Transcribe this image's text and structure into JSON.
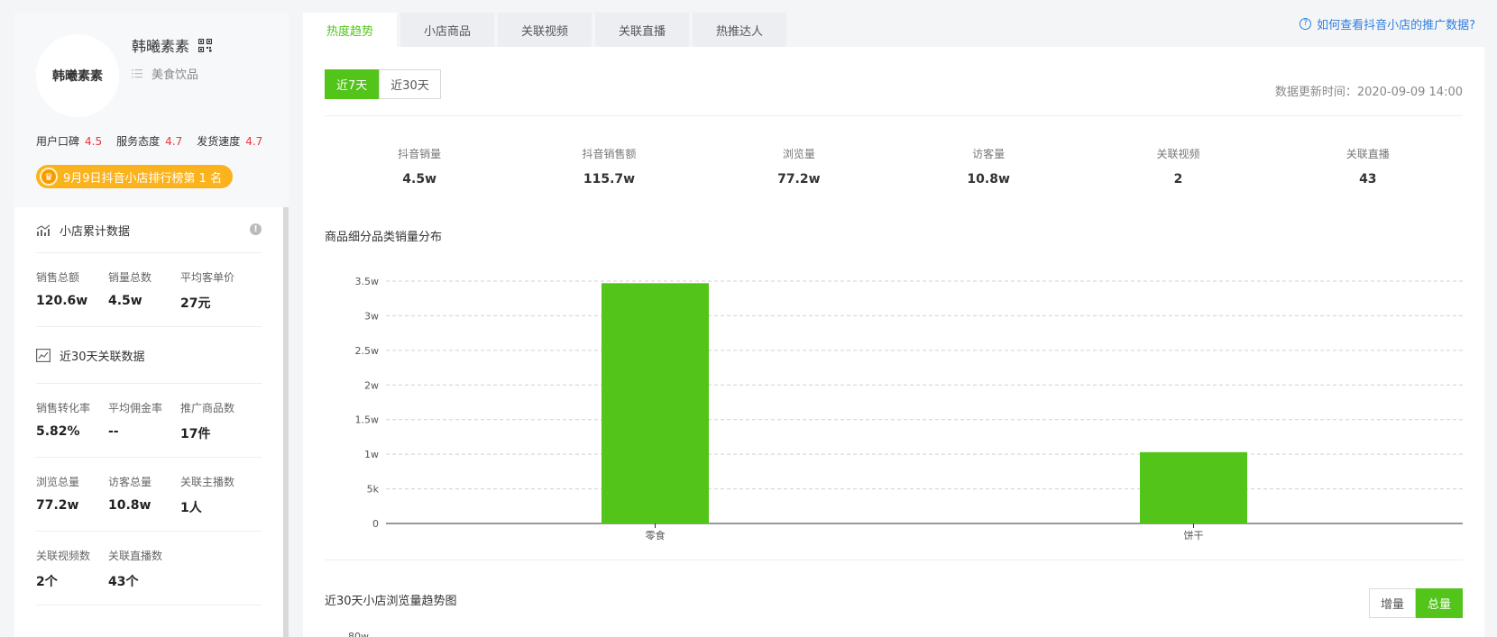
{
  "shop": {
    "avatar_text": "韩曦素素",
    "name": "韩曦素素",
    "category": "美食饮品",
    "ratings": [
      {
        "label": "用户口碑",
        "value": "4.5"
      },
      {
        "label": "服务态度",
        "value": "4.7"
      },
      {
        "label": "发货速度",
        "value": "4.7"
      }
    ],
    "rank_badge": "9月9日抖音小店排行榜第 1 名"
  },
  "cumulative": {
    "title": "小店累计数据",
    "stats": [
      {
        "label": "销售总额",
        "value": "120.6w"
      },
      {
        "label": "销量总数",
        "value": "4.5w"
      },
      {
        "label": "平均客单价",
        "value": "27元"
      }
    ]
  },
  "recent30": {
    "title": "近30天关联数据",
    "rows": [
      [
        {
          "label": "销售转化率",
          "value": "5.82%"
        },
        {
          "label": "平均佣金率",
          "value": "--"
        },
        {
          "label": "推广商品数",
          "value": "17件"
        }
      ],
      [
        {
          "label": "浏览总量",
          "value": "77.2w"
        },
        {
          "label": "访客总量",
          "value": "10.8w"
        },
        {
          "label": "关联主播数",
          "value": "1人"
        }
      ],
      [
        {
          "label": "关联视频数",
          "value": "2个"
        },
        {
          "label": "关联直播数",
          "value": "43个"
        }
      ]
    ]
  },
  "tabs": [
    "热度趋势",
    "小店商品",
    "关联视频",
    "关联直播",
    "热推达人"
  ],
  "help_link": "如何查看抖音小店的推广数据?",
  "range": {
    "options": [
      "近7天",
      "近30天"
    ],
    "selected": "近7天"
  },
  "update_time": "数据更新时间：2020-09-09 14:00",
  "metrics": [
    {
      "label": "抖音销量",
      "value": "4.5w"
    },
    {
      "label": "抖音销售额",
      "value": "115.7w"
    },
    {
      "label": "浏览量",
      "value": "77.2w"
    },
    {
      "label": "访客量",
      "value": "10.8w"
    },
    {
      "label": "关联视频",
      "value": "2"
    },
    {
      "label": "关联直播",
      "value": "43"
    }
  ],
  "chart_title": "商品细分品类销量分布",
  "chart_data": {
    "type": "bar",
    "categories": [
      "零食",
      "饼干"
    ],
    "values": [
      34700,
      10300
    ],
    "ylim": [
      0,
      35000
    ],
    "yticks": [
      0,
      5000,
      10000,
      15000,
      20000,
      25000,
      30000,
      35000
    ],
    "ytick_labels": [
      "0",
      "5k",
      "1w",
      "1.5w",
      "2w",
      "2.5w",
      "3w",
      "3.5w"
    ],
    "grid": true,
    "bar_color": "#52c41a"
  },
  "chart2": {
    "title": "近30天小店浏览量趋势图",
    "modes": [
      "增量",
      "总量"
    ],
    "selected_mode": "总量",
    "first_tick": "80w"
  },
  "colors": {
    "accent": "#52c41a",
    "rating": "#e8383d",
    "badge": "#fbb31d",
    "link": "#2f7fe0"
  }
}
